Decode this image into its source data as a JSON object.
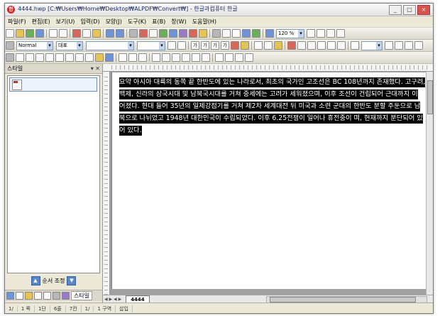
{
  "window": {
    "app_icon_text": "한",
    "title": "4444.hwp  [C:₩Users₩Home₩Desktop₩ALPDF₩Convert₩]  - 한글과컴퓨터 한글",
    "buttons": [
      "_",
      "□",
      "×"
    ]
  },
  "menu": {
    "items": [
      "파일(F)",
      "편집(E)",
      "보기(U)",
      "입력(D)",
      "모양(J)",
      "도구(K)",
      "표(B)",
      "창(W)",
      "도움말(H)"
    ]
  },
  "toolbar": {
    "zoom": "120 %",
    "style": "Normal",
    "font_lang": "대표",
    "font_name": "",
    "font_size": "",
    "char_label": "가"
  },
  "style_panel": {
    "title": "스타일",
    "order_label": "순서 조정",
    "tab_label": "스타일"
  },
  "document": {
    "tab_name": "4444",
    "lines": [
      "요약 아시아 대륙의 동쪽 끝 한반도에 있는 나라로서, 최초의 국가인 고조선은 BC 108년까지 존재했다. 고구려,",
      "백제, 신라의 삼국시대 및 남북국시대를 거쳐 중세에는 고려가 세워졌으며, 이후 조선이 건립되어 근대까지 이",
      "어졌다. 현대 들어 35년의 일제강점기를 거쳐 제2차 세계대전 뒤 미국과 소련 군대의 한반도 분할 주둔으로 남",
      "북으로 나뉘었고 1948년 대한민국이 수립되었다. 이후 6.25전쟁이 일어나 휴전중이 며, 현재까지 분단되어 있",
      "어 있다."
    ]
  },
  "status": {
    "page": "1/",
    "section": "1 쪽",
    "section_label": "1단",
    "line": "6줄",
    "col": "7칸",
    "page2": "1/",
    "area": "1 구역",
    "mode": "삽입"
  }
}
